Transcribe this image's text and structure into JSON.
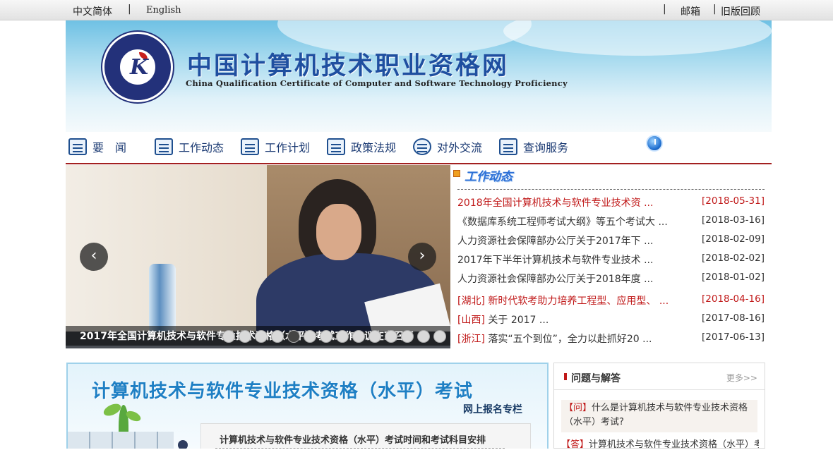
{
  "topbar": {
    "lang_zh": "中文简体",
    "sep": "|",
    "lang_en": "English",
    "mail": "邮箱",
    "old": "旧版回顾"
  },
  "banner": {
    "title": "中国计算机技术职业资格网",
    "subtitle": "China Qualification Certificate of Computer and Software Technology Proficiency"
  },
  "nav": {
    "items": [
      {
        "label": "要　闻",
        "icon": "news-icon"
      },
      {
        "label": "工作动态",
        "icon": "calendar-icon"
      },
      {
        "label": "工作计划",
        "icon": "plan-icon"
      },
      {
        "label": "政策法规",
        "icon": "printer-icon"
      },
      {
        "label": "对外交流",
        "icon": "globe-icon"
      },
      {
        "label": "查询服务",
        "icon": "monitor-icon"
      }
    ]
  },
  "slider": {
    "caption": "2017年全国计算机技术与软件专业技术资格（水平）考试工作会议在京召开",
    "prev": "‹",
    "next": "›",
    "dot_count": 14,
    "active_dot": 4
  },
  "news": {
    "heading": "工作动态",
    "items": [
      {
        "title": "2018年全国计算机技术与软件专业技术资 ...",
        "date": "[2018-05-31]",
        "red": true,
        "tag": ""
      },
      {
        "title": "《数据库系统工程师考试大纲》等五个考试大 ...",
        "date": "[2018-03-16]",
        "red": false,
        "tag": ""
      },
      {
        "title": "人力资源社会保障部办公厅关于2017年下 ...",
        "date": "[2018-02-09]",
        "red": false,
        "tag": ""
      },
      {
        "title": "2017年下半年计算机技术与软件专业技术 ...",
        "date": "[2018-02-02]",
        "red": false,
        "tag": ""
      },
      {
        "title": "人力资源社会保障部办公厅关于2018年度 ...",
        "date": "[2018-01-02]",
        "red": false,
        "tag": ""
      },
      {
        "title": "新时代软考助力培养工程型、应用型、 ...",
        "date": "[2018-04-16]",
        "red": true,
        "tag": "[湖北]"
      },
      {
        "title": "关于 2017 ...",
        "date": "[2017-08-16]",
        "red": false,
        "tag": "[山西]"
      },
      {
        "title": "落实“五个到位”，全力以赴抓好20 ...",
        "date": "[2017-06-13]",
        "red": false,
        "tag": "[浙江]"
      }
    ]
  },
  "exam": {
    "title": "计算机技术与软件专业技术资格（水平）考试",
    "sub": "网上报名专栏",
    "link": "计算机技术与软件专业技术资格（水平）考试时间和考试科目安排"
  },
  "qa": {
    "title": "问题与解答",
    "more": "更多>>",
    "q_tag": "【问】",
    "q_text": "什么是计算机技术与软件专业技术资格（水平）考试?",
    "a_tag": "【答】",
    "a_text": "计算机技术与软件专业技术资格（水平）考"
  }
}
